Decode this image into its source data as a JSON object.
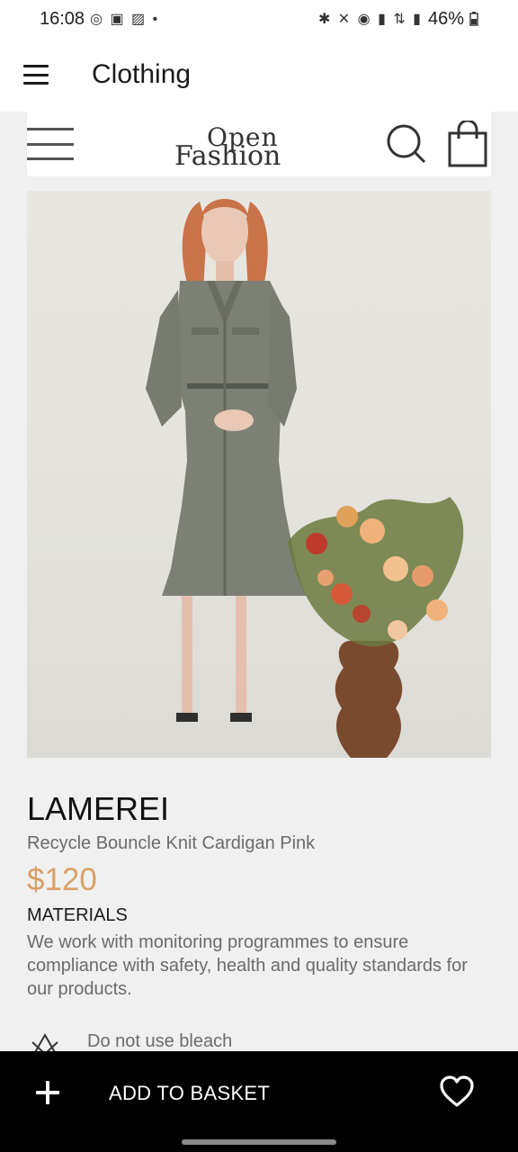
{
  "status": {
    "time": "16:08",
    "battery": "46%",
    "icons_left": [
      "whatsapp-icon",
      "media-icon",
      "gallery-icon",
      "dot"
    ],
    "icons_right": [
      "bluetooth-icon",
      "mute-icon",
      "hotspot-icon",
      "signal-icon",
      "4g-icon",
      "signal-icon",
      "battery-icon"
    ]
  },
  "app_bar": {
    "title": "Clothing"
  },
  "web_header": {
    "logo_top": "Open",
    "logo_bottom": "Fashion"
  },
  "product": {
    "brand": "LAMEREI",
    "name": "Recycle Bouncle Knit Cardigan Pink",
    "price": "$120",
    "materials_title": "MATERIALS",
    "materials_text": "We work with monitoring programmes to ensure compliance with safety, health and quality standards for our products.",
    "care_items": [
      {
        "icon": "no-bleach-icon",
        "label": "Do not use bleach"
      }
    ]
  },
  "bottom_bar": {
    "add_label": "ADD TO BASKET"
  },
  "colors": {
    "accent_price": "#d9a066",
    "bottom_bar": "#000000",
    "background": "#f0f0f0"
  }
}
